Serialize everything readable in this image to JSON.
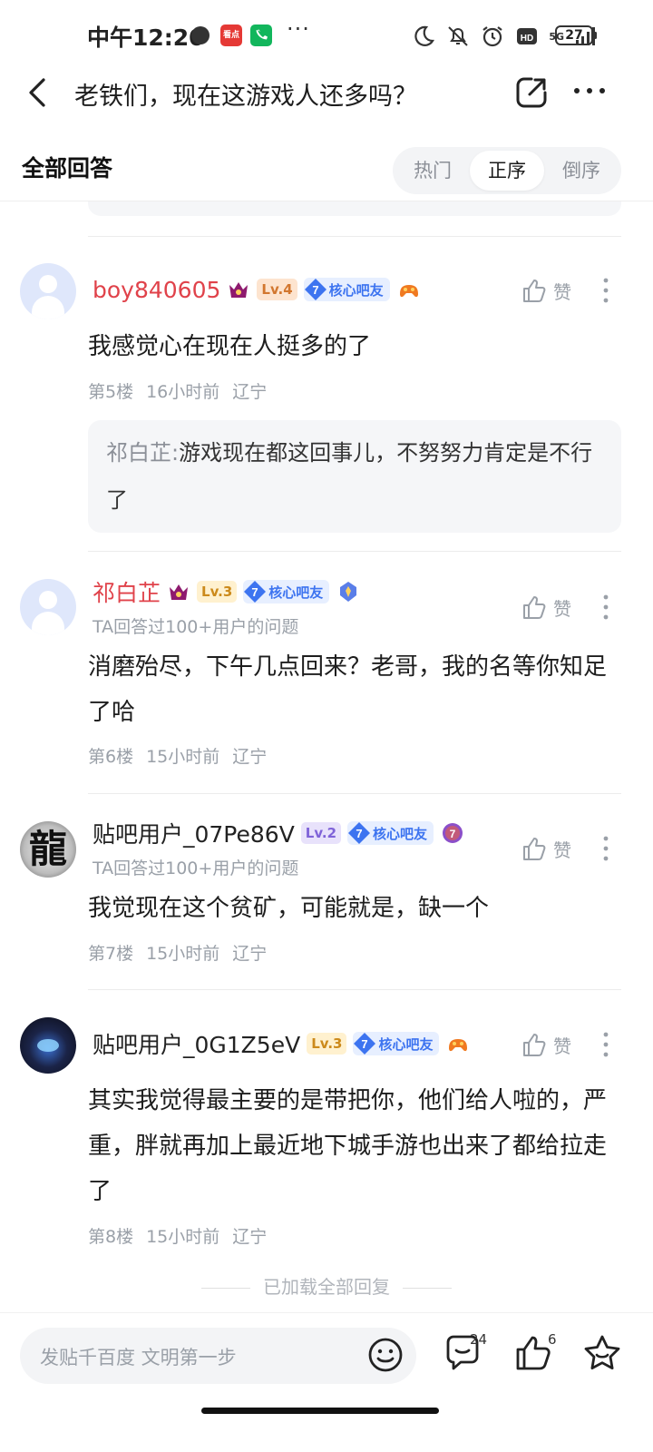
{
  "status_bar": {
    "time": "中午12:20",
    "app_icon_label": "看点",
    "network": "5G",
    "battery": "27"
  },
  "topbar": {
    "title": "老铁们，现在这游戏人还多吗？"
  },
  "answers": {
    "title": "全部回答",
    "sort_tabs": [
      {
        "label": "热门",
        "active": false
      },
      {
        "label": "正序",
        "active": true
      },
      {
        "label": "倒序",
        "active": false
      }
    ]
  },
  "posts": [
    {
      "username": "boy840605",
      "level": "Lv.4",
      "core_badge": {
        "num": "7",
        "label": "核心吧友"
      },
      "like_label": "赞",
      "content": "我感觉心在现在人挺多的了",
      "floor": "第5楼",
      "time": "16小时前",
      "location": "辽宁",
      "quote": {
        "author": "祁白芷:",
        "text": "游戏现在都这回事儿，不努努力肯定是不行了"
      }
    },
    {
      "username": "祁白芷",
      "level": "Lv.3",
      "core_badge": {
        "num": "7",
        "label": "核心吧友"
      },
      "sub": "TA回答过100+用户的问题",
      "like_label": "赞",
      "content": "消磨殆尽，下午几点回来？老哥，我的名等你知足了哈",
      "floor": "第6楼",
      "time": "15小时前",
      "location": "辽宁"
    },
    {
      "username": "贴吧用户_07Pe86V",
      "avatar_text": "龍",
      "level": "Lv.2",
      "core_badge": {
        "num": "7",
        "label": "核心吧友"
      },
      "extra_badge_num": "7",
      "sub": "TA回答过100+用户的问题",
      "like_label": "赞",
      "content": "我觉现在这个贫矿，可能就是，缺一个",
      "floor": "第7楼",
      "time": "15小时前",
      "location": "辽宁"
    },
    {
      "username": "贴吧用户_0G1Z5eV",
      "level": "Lv.3",
      "core_badge": {
        "num": "7",
        "label": "核心吧友"
      },
      "like_label": "赞",
      "content": "其实我觉得最主要的是带把你，他们给人啦的，严重，胖就再加上最近地下城手游也出来了都给拉走了",
      "floor": "第8楼",
      "time": "15小时前",
      "location": "辽宁"
    }
  ],
  "loaded_all_text": "已加载全部回复",
  "bottom_bar": {
    "placeholder": "发贴千百度 文明第一步",
    "comment_count": "24",
    "like_count": "6"
  },
  "colors": {
    "accent_blue": "#3d74f0",
    "name_red": "#e0424a",
    "muted": "#9aa0a8"
  }
}
